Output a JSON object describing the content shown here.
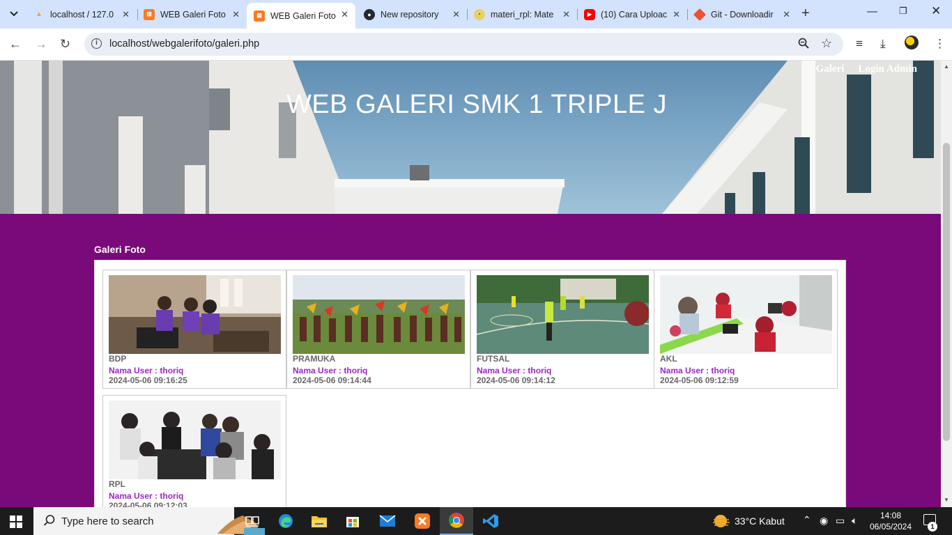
{
  "browser": {
    "tabs": [
      {
        "title": "localhost / 127.0",
        "favicon": "phpmyadmin-icon",
        "color": "#f5a623"
      },
      {
        "title": "WEB Galeri Foto",
        "favicon": "xampp-icon",
        "color": "#fb7a24"
      },
      {
        "title": "WEB Galeri Foto",
        "favicon": "xampp-icon",
        "color": "#fb7a24",
        "active": true
      },
      {
        "title": "New repository",
        "favicon": "github-icon",
        "color": "#24292f"
      },
      {
        "title": "materi_rpl: Mate",
        "favicon": "file-icon",
        "color": "#c8a400"
      },
      {
        "title": "(10) Cara Uploac",
        "favicon": "youtube-icon",
        "color": "#ff0000"
      },
      {
        "title": "Git - Downloadir",
        "favicon": "git-icon",
        "color": "#f05133"
      }
    ],
    "url": "localhost/webgalerifoto/galeri.php"
  },
  "site": {
    "nav": {
      "galeri": "Galeri",
      "login": "Login Admin"
    },
    "title": "WEB GALERI SMK 1 TRIPLE J",
    "section_title": "Galeri Foto",
    "photos": [
      {
        "name": "BDP",
        "user": "Nama User : thoriq",
        "date": "2024-05-06 09:16:25"
      },
      {
        "name": "PRAMUKA",
        "user": "Nama User : thoriq",
        "date": "2024-05-06 09:14:44"
      },
      {
        "name": "FUTSAL",
        "user": "Nama User : thoriq",
        "date": "2024-05-06 09:14:12"
      },
      {
        "name": "AKL",
        "user": "Nama User : thoriq",
        "date": "2024-05-06 09:12:59"
      },
      {
        "name": "RPL",
        "user": "Nama User : thoriq",
        "date": "2024-05-06 09:12:03"
      }
    ]
  },
  "taskbar": {
    "search_placeholder": "Type here to search",
    "weather": "33°C  Kabut",
    "time": "14:08",
    "date": "06/05/2024",
    "notifications": "1"
  },
  "colors": {
    "page_bg": "#7a0a7a",
    "user_text": "#9b27c6"
  }
}
